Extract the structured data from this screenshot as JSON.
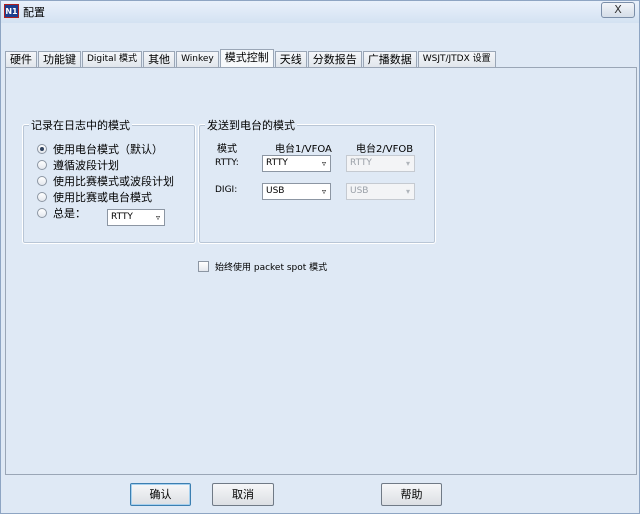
{
  "window": {
    "title": "配置",
    "app_icon": "N1",
    "close_label": "X"
  },
  "tabs": [
    {
      "label": "硬件"
    },
    {
      "label": "功能键"
    },
    {
      "label": "Digital 模式"
    },
    {
      "label": "其他"
    },
    {
      "label": "Winkey"
    },
    {
      "label": "模式控制"
    },
    {
      "label": "天线"
    },
    {
      "label": "分数报告"
    },
    {
      "label": "广播数据"
    },
    {
      "label": "WSJT/JTDX 设置"
    }
  ],
  "log_mode_group": {
    "title": "记录在日志中的模式",
    "options": [
      {
        "label": "使用电台模式（默认）",
        "checked": true
      },
      {
        "label": "遵循波段计划",
        "checked": false
      },
      {
        "label": "使用比赛模式或波段计划",
        "checked": false
      },
      {
        "label": "使用比赛或电台模式",
        "checked": false
      },
      {
        "label": "总是：",
        "checked": false
      }
    ],
    "always_select": "RTTY"
  },
  "send_mode_group": {
    "title": "发送到电台的模式",
    "col_mode": "模式",
    "col_radio1": "电台1/VFOA",
    "col_radio2": "电台2/VFOB",
    "rows": [
      {
        "label": "RTTY:",
        "radio1": "RTTY",
        "radio2": "RTTY"
      },
      {
        "label": "DIGI:",
        "radio1": "USB",
        "radio2": "USB"
      }
    ]
  },
  "packet_spot": {
    "label": "始终使用 packet spot 模式",
    "checked": false
  },
  "buttons": {
    "ok": "确认",
    "cancel": "取消",
    "help": "帮助"
  }
}
